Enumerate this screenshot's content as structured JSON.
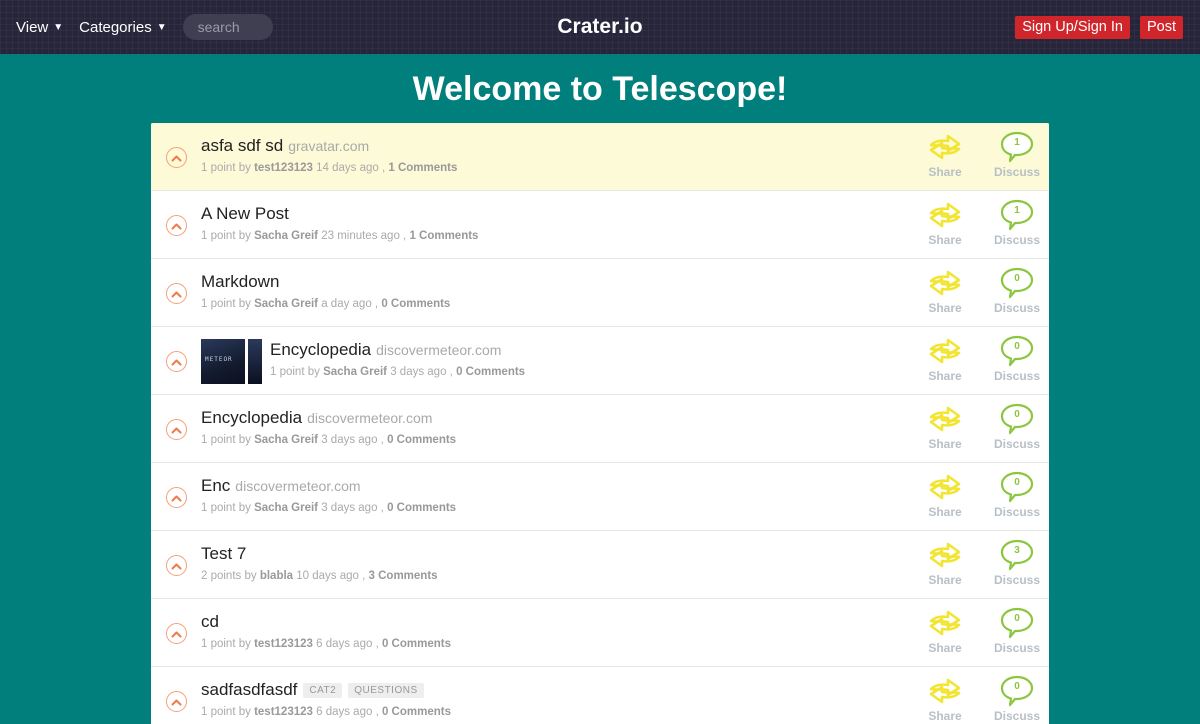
{
  "header": {
    "view_label": "View",
    "categories_label": "Categories",
    "search_placeholder": "search",
    "logo": "Crater.io",
    "signin_label": "Sign Up/Sign In",
    "post_label": "Post"
  },
  "page": {
    "title": "Welcome to Telescope!"
  },
  "colors": {
    "background": "#007f7c",
    "header": "#26253a",
    "accent_red": "#d0262b",
    "share_yellow": "#f2e531",
    "discuss_green": "#8cc63f"
  },
  "icons": {
    "upvote": "chevron-up-icon",
    "share": "share-arrows-icon",
    "discuss": "speech-bubble-icon"
  },
  "actions": {
    "share_label": "Share",
    "discuss_label": "Discuss"
  },
  "posts": [
    {
      "rank": "1",
      "title": "asfa sdf sd",
      "domain": "gravatar.com",
      "points": "1 point by",
      "author": "test123123",
      "time": "14 days ago ,",
      "comments": "1 Comments",
      "comment_count": "1",
      "tags": [],
      "thumbnail": false,
      "highlight": true
    },
    {
      "rank": "2",
      "title": "A New Post",
      "domain": "",
      "points": "1 point by",
      "author": "Sacha Greif",
      "time": "23 minutes ago ,",
      "comments": "1 Comments",
      "comment_count": "1",
      "tags": [],
      "thumbnail": false,
      "highlight": false
    },
    {
      "rank": "3",
      "title": "Markdown",
      "domain": "",
      "points": "1 point by",
      "author": "Sacha Greif",
      "time": "a day ago ,",
      "comments": "0 Comments",
      "comment_count": "0",
      "tags": [],
      "thumbnail": false,
      "highlight": false
    },
    {
      "rank": "4",
      "title": "Encyclopedia",
      "domain": "discovermeteor.com",
      "points": "1 point by",
      "author": "Sacha Greif",
      "time": "3 days ago ,",
      "comments": "0 Comments",
      "comment_count": "0",
      "tags": [],
      "thumbnail": true,
      "highlight": false
    },
    {
      "rank": "5",
      "title": "Encyclopedia",
      "domain": "discovermeteor.com",
      "points": "1 point by",
      "author": "Sacha Greif",
      "time": "3 days ago ,",
      "comments": "0 Comments",
      "comment_count": "0",
      "tags": [],
      "thumbnail": false,
      "highlight": false
    },
    {
      "rank": "6",
      "title": "Enc",
      "domain": "discovermeteor.com",
      "points": "1 point by",
      "author": "Sacha Greif",
      "time": "3 days ago ,",
      "comments": "0 Comments",
      "comment_count": "0",
      "tags": [],
      "thumbnail": false,
      "highlight": false
    },
    {
      "rank": "7",
      "title": "Test 7",
      "domain": "",
      "points": "2 points by",
      "author": "blabla",
      "time": "10 days ago ,",
      "comments": "3 Comments",
      "comment_count": "3",
      "tags": [],
      "thumbnail": false,
      "highlight": false
    },
    {
      "rank": "8",
      "title": "cd",
      "domain": "",
      "points": "1 point by",
      "author": "test123123",
      "time": "6 days ago ,",
      "comments": "0 Comments",
      "comment_count": "0",
      "tags": [],
      "thumbnail": false,
      "highlight": false
    },
    {
      "rank": "9",
      "title": "sadfasdfasdf",
      "domain": "",
      "points": "1 point by",
      "author": "test123123",
      "time": "6 days ago ,",
      "comments": "0 Comments",
      "comment_count": "0",
      "tags": [
        "CAT2",
        "QUESTIONS"
      ],
      "thumbnail": false,
      "highlight": false
    }
  ]
}
